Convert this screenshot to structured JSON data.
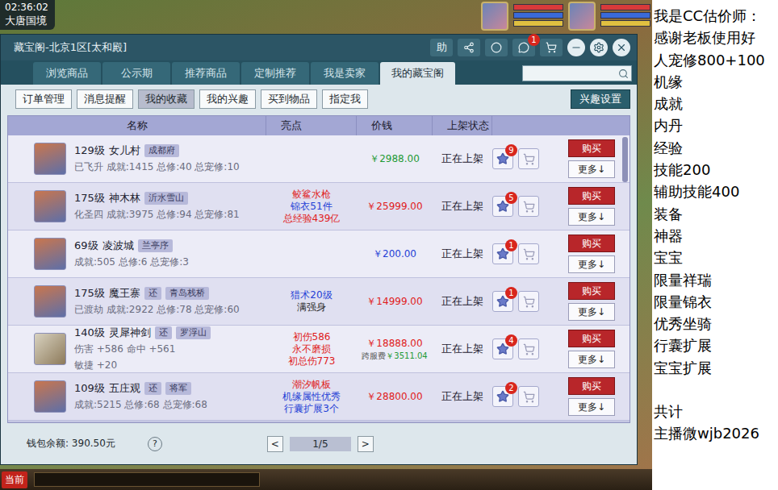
{
  "hud": {
    "time": "02:36:02",
    "location": "大唐国境"
  },
  "window": {
    "title": "藏宝阁-北京1区[太和殿]",
    "help": "助",
    "message_count": "1"
  },
  "tabs": [
    {
      "label": "浏览商品",
      "selected": false
    },
    {
      "label": "公示期",
      "selected": false
    },
    {
      "label": "推荐商品",
      "selected": false
    },
    {
      "label": "定制推荐",
      "selected": false
    },
    {
      "label": "我是卖家",
      "selected": false
    },
    {
      "label": "我的藏宝阁",
      "selected": true
    }
  ],
  "subtabs": [
    {
      "label": "订单管理",
      "selected": false
    },
    {
      "label": "消息提醒",
      "selected": false
    },
    {
      "label": "我的收藏",
      "selected": true
    },
    {
      "label": "我的兴趣",
      "selected": false
    },
    {
      "label": "买到物品",
      "selected": false
    },
    {
      "label": "指定我",
      "selected": false
    }
  ],
  "interest_button": "兴趣设置",
  "table": {
    "columns": [
      "名称",
      "亮点",
      "价钱",
      "上架状态"
    ],
    "row_buttons": [
      "购买",
      "更多↓"
    ],
    "rows": [
      {
        "kind": "character",
        "level": "129级",
        "name": "女儿村",
        "return_tag": "",
        "server": "成都府",
        "stats": [
          "已飞升 成就:1415 总修:40 总宠修:10"
        ],
        "highlights": [],
        "price": "￥2988.00",
        "price_color": "#1f9a35",
        "fee_label": "",
        "fee_amount": "",
        "status": "正在上架",
        "favorites": "9"
      },
      {
        "kind": "character",
        "level": "175级",
        "name": "神木林",
        "return_tag": "",
        "server": "沂水雪山",
        "stats": [
          "化圣四 成就:3975 总修:94 总宠修:81"
        ],
        "highlights": [
          {
            "text": "鲛鲨水枪",
            "color": "#e01b1b"
          },
          {
            "text": "锦衣51件",
            "color": "#1f3fd6"
          },
          {
            "text": "总经验439亿",
            "color": "#e01b1b"
          }
        ],
        "price": "￥25999.00",
        "price_color": "#e01b1b",
        "fee_label": "",
        "fee_amount": "",
        "status": "正在上架",
        "favorites": "5"
      },
      {
        "kind": "character",
        "level": "69级",
        "name": "凌波城",
        "return_tag": "",
        "server": "兰亭序",
        "stats": [
          "成就:505 总修:6 总宠修:3"
        ],
        "highlights": [],
        "price": "￥200.00",
        "price_color": "#1f3fd6",
        "fee_label": "",
        "fee_amount": "",
        "status": "正在上架",
        "favorites": "1"
      },
      {
        "kind": "character",
        "level": "175级",
        "name": "魔王寨",
        "return_tag": "还",
        "server": "青岛栈桥",
        "stats": [
          "已渡劫 成就:2922 总修:78 总宠修:60"
        ],
        "highlights": [
          {
            "text": "猎术20级",
            "color": "#1f3fd6"
          },
          {
            "text": "满强身",
            "color": "#222222"
          }
        ],
        "price": "￥14999.00",
        "price_color": "#e01b1b",
        "fee_label": "",
        "fee_amount": "",
        "status": "正在上架",
        "favorites": "1"
      },
      {
        "kind": "weapon",
        "level": "140级",
        "name": "灵犀神剑",
        "return_tag": "还",
        "server": "罗浮山",
        "stats": [
          "伤害 +586 命中 +561",
          "敏捷 +20"
        ],
        "highlights": [
          {
            "text": "初伤586",
            "color": "#e01b1b"
          },
          {
            "text": "永不磨损",
            "color": "#e01b1b"
          },
          {
            "text": "初总伤773",
            "color": "#e01b1b"
          }
        ],
        "price": "￥18888.00",
        "price_color": "#e01b1b",
        "fee_label": "跨服费",
        "fee_amount": "￥3511.04",
        "status": "正在上架",
        "favorites": "4"
      },
      {
        "kind": "character",
        "level": "109级",
        "name": "五庄观",
        "return_tag": "还",
        "server": "将军",
        "stats": [
          "成就:5215 总修:68 总宠修:68"
        ],
        "highlights": [
          {
            "text": "潮汐帆板",
            "color": "#e01b1b"
          },
          {
            "text": "机缘属性优秀",
            "color": "#1f3fd6"
          },
          {
            "text": "行囊扩展3个",
            "color": "#1f3fd6"
          }
        ],
        "price": "￥28800.00",
        "price_color": "#e01b1b",
        "fee_label": "",
        "fee_amount": "",
        "status": "正在上架",
        "favorites": "2"
      }
    ]
  },
  "footer": {
    "wallet": "钱包余额: 390.50元",
    "help": "?",
    "prev": "<",
    "page": "1/5",
    "next": ">"
  },
  "taskbar": {
    "label": "当前"
  },
  "side_panel": {
    "lines": [
      "我是CC估价师：",
      "感谢老板使用好",
      "人宠修800+100",
      "机缘",
      "成就",
      "内丹",
      "经验",
      "技能200",
      "辅助技能400",
      "装备",
      "神器",
      "宝宝",
      "限量祥瑞",
      "限量锦衣",
      "优秀坐骑",
      "行囊扩展",
      "宝宝扩展"
    ],
    "total": "共计",
    "contact": "主播微wjb2026"
  }
}
